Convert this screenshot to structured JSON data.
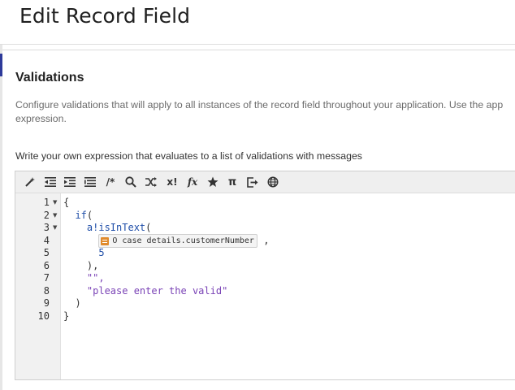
{
  "page": {
    "title": "Edit Record Field"
  },
  "validations": {
    "heading": "Validations",
    "description_line1": "Configure validations that will apply to all instances of the record field throughout your application. Use the app",
    "description_line2": "expression.",
    "expression_label": "Write your own expression that evaluates to a list of validations with messages"
  },
  "toolbar": {
    "icons": [
      "magic-wand-icon",
      "outdent-icon",
      "indent-icon",
      "list-format-icon",
      "comment-icon",
      "search-icon",
      "shuffle-icon",
      "exclamation-x-icon",
      "fx-icon",
      "star-icon",
      "pi-icon",
      "export-icon",
      "globe-icon"
    ],
    "comment_glyph": "/*",
    "exclamation_glyph": "x!",
    "fx_glyph": "fx",
    "pi_glyph": "π"
  },
  "editor": {
    "line_numbers": [
      "1",
      "2",
      "3",
      "4",
      "5",
      "6",
      "7",
      "8",
      "9",
      "10"
    ],
    "foldable_lines": [
      1,
      2,
      3
    ],
    "lines": {
      "l1": "{",
      "l2_fn": "if",
      "l2_open": "(",
      "l3_ns": "a!",
      "l3_fn": "isInText",
      "l3_open": "(",
      "l4_chip": "O case details.customerNumber",
      "l4_comma": ",",
      "l5": "5",
      "l6": "),",
      "l7": "\"\",",
      "l8": "\"please enter the valid\"",
      "l9": ")",
      "l10": "}"
    }
  },
  "colors": {
    "function": "#1f4ea8",
    "string": "#7a43b6",
    "record_chip": "#e08a2c",
    "accent": "#2e3a9a"
  }
}
